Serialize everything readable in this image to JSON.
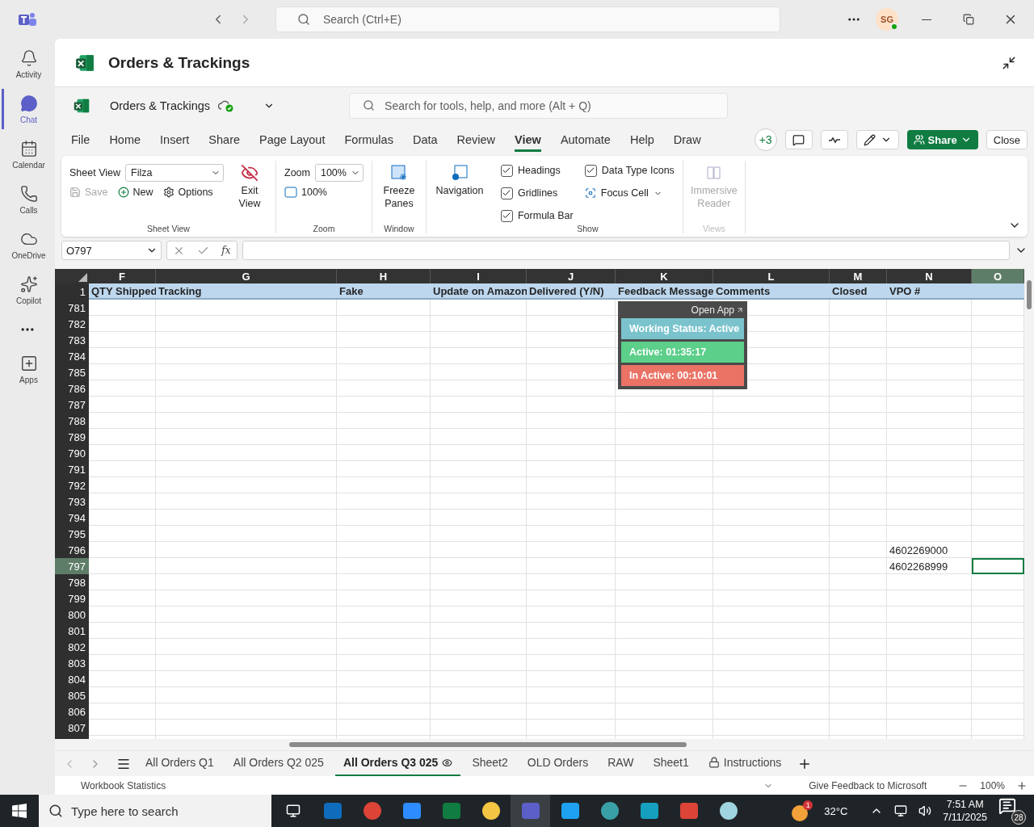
{
  "top_bar": {
    "search_placeholder": "Search (Ctrl+E)",
    "avatar": "SG"
  },
  "rail": {
    "items": [
      {
        "label": "Activity",
        "selected": false
      },
      {
        "label": "Chat",
        "selected": true
      },
      {
        "label": "Calendar",
        "selected": false
      },
      {
        "label": "Calls",
        "selected": false
      },
      {
        "label": "OneDrive",
        "selected": false
      },
      {
        "label": "Copilot",
        "selected": false
      }
    ],
    "apps_label": "Apps"
  },
  "app_header": {
    "title": "Orders & Trackings"
  },
  "workbook_bar": {
    "file_name": "Orders & Trackings",
    "search_placeholder": "Search for tools, help, and more (Alt + Q)"
  },
  "menu_tabs": [
    {
      "label": "File",
      "selected": false
    },
    {
      "label": "Home",
      "selected": false
    },
    {
      "label": "Insert",
      "selected": false
    },
    {
      "label": "Share",
      "selected": false
    },
    {
      "label": "Page Layout",
      "selected": false
    },
    {
      "label": "Formulas",
      "selected": false
    },
    {
      "label": "Data",
      "selected": false
    },
    {
      "label": "Review",
      "selected": false
    },
    {
      "label": "View",
      "selected": true
    },
    {
      "label": "Automate",
      "selected": false
    },
    {
      "label": "Help",
      "selected": false
    },
    {
      "label": "Draw",
      "selected": false
    }
  ],
  "menu_actions": {
    "collaborators": "+3",
    "share": "Share",
    "close": "Close"
  },
  "ribbon": {
    "sheet_view": {
      "title": "Sheet View",
      "field_label": "Sheet View",
      "view_name": "Filza",
      "actions": [
        {
          "label": "Save",
          "disabled": true
        },
        {
          "label": "New",
          "disabled": false
        },
        {
          "label": "Options",
          "disabled": false
        }
      ],
      "exit_label": "Exit View"
    },
    "zoom": {
      "title": "Zoom",
      "label": "Zoom",
      "value": "100%",
      "reset_label": "100%"
    },
    "window": {
      "title": "Window",
      "freeze_label": "Freeze Panes"
    },
    "navigation_label": "Navigation",
    "show": {
      "title": "Show",
      "options": [
        {
          "label": "Headings",
          "checked": true
        },
        {
          "label": "Gridlines",
          "checked": true
        },
        {
          "label": "Formula Bar",
          "checked": true
        },
        {
          "label": "Data Type Icons",
          "checked": true
        }
      ],
      "focus_cell": "Focus Cell"
    },
    "views": {
      "title": "Views",
      "immersive_label": "Immersive Reader",
      "disabled": true
    }
  },
  "formula_bar": {
    "name_box": "O797",
    "function_symbol": "fx"
  },
  "grid": {
    "columns": [
      {
        "letter": "F",
        "header": "QTY Shipped",
        "selected": false
      },
      {
        "letter": "G",
        "header": "Tracking",
        "selected": false
      },
      {
        "letter": "H",
        "header": "Fake",
        "selected": false
      },
      {
        "letter": "I",
        "header": "Update on Amazon",
        "selected": false
      },
      {
        "letter": "J",
        "header": "Delivered (Y/N)",
        "selected": false
      },
      {
        "letter": "K",
        "header": "Feedback Message",
        "selected": false
      },
      {
        "letter": "L",
        "header": "Comments",
        "selected": false
      },
      {
        "letter": "M",
        "header": "Closed",
        "selected": false
      },
      {
        "letter": "N",
        "header": "VPO #",
        "selected": false
      },
      {
        "letter": "O",
        "selected": true
      }
    ],
    "header_row_number": "1",
    "rows": [
      {
        "number": "781",
        "selected": false
      },
      {
        "number": "782",
        "selected": false
      },
      {
        "number": "783",
        "selected": false
      },
      {
        "number": "784",
        "selected": false
      },
      {
        "number": "785",
        "selected": false
      },
      {
        "number": "786",
        "selected": false
      },
      {
        "number": "787",
        "selected": false
      },
      {
        "number": "788",
        "selected": false
      },
      {
        "number": "789",
        "selected": false
      },
      {
        "number": "790",
        "selected": false
      },
      {
        "number": "791",
        "selected": false
      },
      {
        "number": "792",
        "selected": false
      },
      {
        "number": "793",
        "selected": false
      },
      {
        "number": "794",
        "selected": false
      },
      {
        "number": "795",
        "selected": false
      },
      {
        "number": "796",
        "selected": false,
        "vpo": "4602269000"
      },
      {
        "number": "797",
        "selected": true,
        "vpo": "4602268999"
      },
      {
        "number": "798",
        "selected": false
      },
      {
        "number": "799",
        "selected": false
      },
      {
        "number": "800",
        "selected": false
      },
      {
        "number": "801",
        "selected": false
      },
      {
        "number": "802",
        "selected": false
      },
      {
        "number": "803",
        "selected": false
      },
      {
        "number": "804",
        "selected": false
      },
      {
        "number": "805",
        "selected": false
      },
      {
        "number": "806",
        "selected": false
      },
      {
        "number": "807",
        "selected": false
      }
    ]
  },
  "tracker_widget": {
    "link": "Open App",
    "statuses": [
      {
        "label": "Working Status: Active",
        "color": "#7ac3cd"
      },
      {
        "label": "Active: 01:35:17",
        "color": "#5ccf8a"
      },
      {
        "label": "In Active: 00:10:01",
        "color": "#ea7366"
      }
    ]
  },
  "sheet_tabs": [
    {
      "label": "All Orders Q1",
      "selected": false,
      "kind": "plain"
    },
    {
      "label": "All Orders Q2 025",
      "selected": false,
      "kind": "plain"
    },
    {
      "label": "All Orders Q3 025",
      "selected": true,
      "kind": "viewed"
    },
    {
      "label": "Sheet2",
      "selected": false,
      "kind": "plain"
    },
    {
      "label": "OLD Orders",
      "selected": false,
      "kind": "plain"
    },
    {
      "label": "RAW",
      "selected": false,
      "kind": "plain"
    },
    {
      "label": "Sheet1",
      "selected": false,
      "kind": "plain"
    },
    {
      "label": "Instructions",
      "selected": false,
      "kind": "locked"
    }
  ],
  "status_bar": {
    "statistics": "Workbook Statistics",
    "feedback": "Give Feedback to Microsoft",
    "zoom": "100%"
  },
  "taskbar": {
    "search_placeholder": "Type here to search",
    "temperature": "32°C",
    "weather_badge": "1",
    "time": "7:51 AM",
    "date": "7/11/2025",
    "notifications": "28"
  }
}
